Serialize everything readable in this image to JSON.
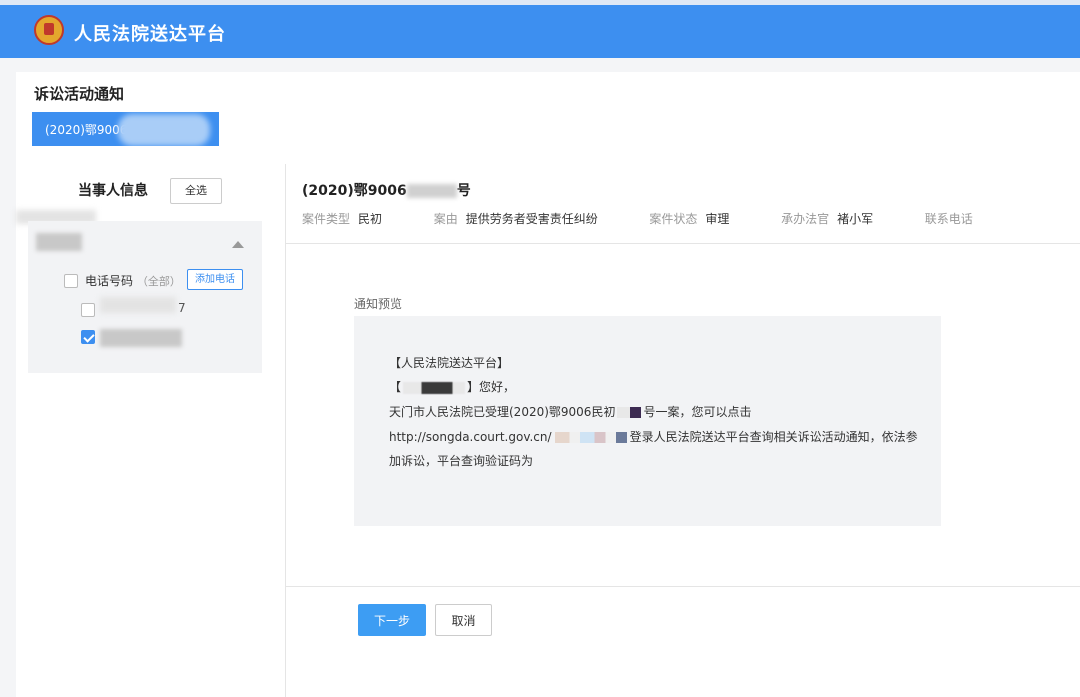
{
  "app": {
    "title": "人民法院送达平台"
  },
  "page": {
    "title": "诉讼活动通知",
    "case_tab_label": "(2020)鄂9006"
  },
  "party_panel": {
    "title": "当事人信息",
    "select_all": "全选",
    "phone_label": "电话号码",
    "phone_scope": "（全部）",
    "add_phone": "添加电话",
    "phone_1_tail": "7",
    "phone_1_checked": false,
    "phone_2_checked": true
  },
  "case_info": {
    "number_prefix": "(2020)鄂9006",
    "number_suffix": "号",
    "type_label": "案件类型",
    "type_value": "民初",
    "cause_label": "案由",
    "cause_value": "提供劳务者受害责任纠纷",
    "status_label": "案件状态",
    "status_value": "审理",
    "judge_label": "承办法官",
    "judge_value": "褚小军",
    "phone_label": "联系电话"
  },
  "preview": {
    "label": "通知预览",
    "line1": "【人民法院送达平台】",
    "line2_open": "【",
    "line2_close": "】您好，",
    "line3_start": "天门市人民法院已受理(2020)鄂9006民初",
    "line3_end": "号一案，您可以点击",
    "line4_start": "http://songda.court.gov.cn/",
    "line4_end": "登录人民法院送达平台查询相关诉讼活动通知，依法参",
    "line5": "加诉讼，平台查询验证码为"
  },
  "actions": {
    "next": "下一步",
    "cancel": "取消"
  }
}
